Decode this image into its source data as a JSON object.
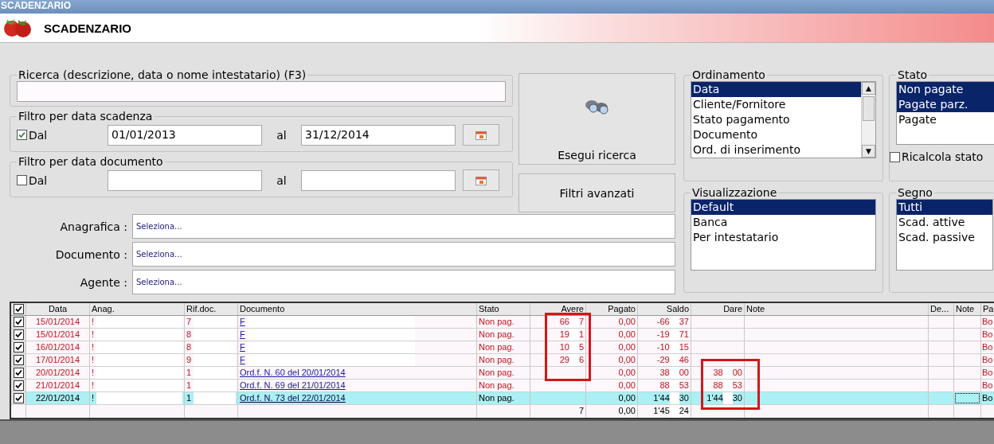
{
  "window": {
    "title": "SCADENZARIO"
  },
  "header": {
    "title": "SCADENZARIO"
  },
  "search": {
    "label": "Ricerca (descrizione, data o nome intestatario) (F3)"
  },
  "filters": [
    {
      "title": "Filtro per data scadenza",
      "checkbox_label": "Dal",
      "checked": true,
      "from": "01/01/2013",
      "to_label": "al",
      "to": "31/12/2014"
    },
    {
      "title": "Filtro per data documento",
      "checkbox_label": "Dal",
      "checked": false,
      "to_label": "al"
    }
  ],
  "buttons": {
    "search": "Esegui ricerca",
    "advanced": "Filtri avanzati"
  },
  "pickers": [
    {
      "label": "Anagrafica :",
      "value": "Seleziona..."
    },
    {
      "label": "Documento :",
      "value": "Seleziona..."
    },
    {
      "label": "Agente :",
      "value": "Seleziona..."
    }
  ],
  "ordinamento": {
    "title": "Ordinamento",
    "scroll_up": "▲",
    "scroll_down": "▼",
    "items": [
      {
        "label": "Data",
        "selected": true
      },
      {
        "label": "Cliente/Fornitore",
        "selected": false
      },
      {
        "label": "Stato pagamento",
        "selected": false
      },
      {
        "label": "Documento",
        "selected": false
      },
      {
        "label": "Ord. di inserimento",
        "selected": false
      }
    ]
  },
  "stato": {
    "title": "Stato",
    "items": [
      {
        "label": "Non pagate",
        "selected": true
      },
      {
        "label": "Pagate parz.",
        "selected": true
      },
      {
        "label": "Pagate",
        "selected": false
      }
    ],
    "recalc": {
      "label": "Ricalcola stato",
      "checked": false
    }
  },
  "visualizzazione": {
    "title": "Visualizzazione",
    "items": [
      {
        "label": "Default",
        "selected": true
      },
      {
        "label": "Banca",
        "selected": false
      },
      {
        "label": "Per intestatario",
        "selected": false
      }
    ]
  },
  "segno": {
    "title": "Segno",
    "items": [
      {
        "label": "Tutti",
        "selected": true
      },
      {
        "label": "Scad. attive",
        "selected": false
      },
      {
        "label": "Scad. passive",
        "selected": false
      }
    ]
  },
  "table": {
    "all_checked": true,
    "columns": [
      {
        "label": "Data"
      },
      {
        "label": "Anag."
      },
      {
        "label": "Rif.doc."
      },
      {
        "label": "Documento",
        "kind": "link"
      },
      {
        "label": "Stato"
      },
      {
        "label": "Avere"
      },
      {
        "label": "Pagato"
      },
      {
        "label": "Saldo"
      },
      {
        "label": "Dare"
      },
      {
        "label": "Note"
      },
      {
        "label": "De..."
      },
      {
        "label": "Note"
      },
      {
        "label": "Pa"
      }
    ],
    "rows": [
      {
        "checked": true,
        "selected": false,
        "overdue": true,
        "note_focused": false,
        "cells": [
          "15/01/2014",
          [
            "!"
          ],
          [
            "7"
          ],
          [
            "F"
          ],
          "Non pag.",
          [
            "66",
            "7"
          ],
          "0,00",
          [
            "-66",
            "37"
          ],
          null,
          null,
          null,
          null,
          "Bo"
        ]
      },
      {
        "checked": true,
        "selected": false,
        "overdue": true,
        "note_focused": false,
        "cells": [
          "15/01/2014",
          [
            "!"
          ],
          [
            "8"
          ],
          [
            "F"
          ],
          "Non pag.",
          [
            "19",
            "1"
          ],
          "0,00",
          [
            "-19",
            "71"
          ],
          null,
          null,
          null,
          null,
          "Bo"
        ]
      },
      {
        "checked": true,
        "selected": false,
        "overdue": true,
        "note_focused": false,
        "cells": [
          "16/01/2014",
          [
            "!"
          ],
          [
            "8"
          ],
          [
            "F"
          ],
          "Non pag.",
          [
            "10",
            "5"
          ],
          "0,00",
          [
            "-10",
            "15"
          ],
          null,
          null,
          null,
          null,
          "Bo"
        ]
      },
      {
        "checked": true,
        "selected": false,
        "overdue": true,
        "note_focused": false,
        "cells": [
          "17/01/2014",
          [
            "!"
          ],
          [
            "9"
          ],
          [
            "F"
          ],
          "Non pag.",
          [
            "29",
            "6"
          ],
          "0,00",
          [
            "-29",
            "46"
          ],
          null,
          null,
          null,
          null,
          "Bo"
        ]
      },
      {
        "checked": true,
        "selected": false,
        "overdue": true,
        "note_focused": false,
        "cells": [
          "20/01/2014",
          [
            "!"
          ],
          [
            "1"
          ],
          "Ord.f. N. 60 del 20/01/2014",
          "Non pag.",
          null,
          "0,00",
          [
            "38",
            "00"
          ],
          [
            "38",
            "00"
          ],
          null,
          null,
          null,
          "Bo"
        ]
      },
      {
        "checked": true,
        "selected": false,
        "overdue": true,
        "note_focused": false,
        "cells": [
          "21/01/2014",
          [
            "!"
          ],
          [
            "1"
          ],
          "Ord.f. N. 69 del 21/01/2014",
          "Non pag.",
          null,
          "0,00",
          [
            "88",
            "53"
          ],
          [
            "88",
            "53"
          ],
          null,
          null,
          null,
          "Bo"
        ]
      },
      {
        "checked": true,
        "selected": true,
        "overdue": false,
        "note_focused": true,
        "cells": [
          "22/01/2014",
          [
            "!"
          ],
          [
            "1"
          ],
          "Ord.f. N. 73 del 22/01/2014",
          "Non pag.",
          null,
          "0,00",
          [
            "1'44",
            "30"
          ],
          [
            "1'44",
            "30"
          ],
          null,
          null,
          null,
          "Bo"
        ]
      }
    ],
    "totals": {
      "avere": "7",
      "pagato": "0,00",
      "saldo": [
        "1'45",
        "24"
      ]
    }
  }
}
